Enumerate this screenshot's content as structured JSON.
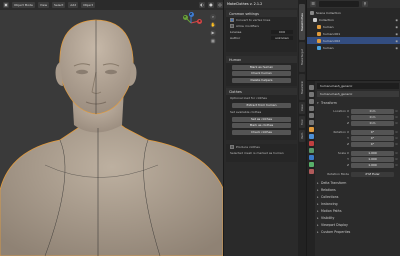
{
  "viewport": {
    "header_buttons": [
      "Object Mode",
      "View",
      "Select",
      "Add",
      "Object"
    ],
    "gizmo": {
      "x": "X",
      "y": "Y",
      "z": "Z"
    }
  },
  "npanel": {
    "title": "MakeClothes v. 2.1.2",
    "common": {
      "title": "Common settings",
      "convert_label": "Convert to vertex lines",
      "allow_label": "Allow modifiers",
      "license_label": "License",
      "license_value": "CC0",
      "author_label": "Author",
      "author_value": "unknown"
    },
    "human": {
      "title": "Human",
      "buttons": [
        "Mark as human",
        "Check human",
        "Delete helpers"
      ]
    },
    "clothes": {
      "title": "Clothes",
      "optional_label": "Optional load for clothes",
      "extract_btn": "Extract from human",
      "base_label": "Set available clothes",
      "set_btn": "Set as clothes",
      "mark_btn": "Mark as clothes",
      "check_btn": "Check clothes"
    },
    "produce": {
      "title": "Produce clothes",
      "status": "Selected mesh is marked as human"
    }
  },
  "vertical_tabs": [
    "MakeClothes",
    "MakeTarget",
    "MakeSkin",
    "View",
    "Tool",
    "Item"
  ],
  "outliner": {
    "rows": [
      {
        "label": "Scene Collection",
        "selected": false,
        "icon_color": "#888888"
      },
      {
        "label": "Collection",
        "selected": false,
        "icon_color": "#cccccc"
      },
      {
        "label": "human",
        "selected": false,
        "icon_color": "#e09b3c"
      },
      {
        "label": "human:001",
        "selected": false,
        "icon_color": "#e09b3c"
      },
      {
        "label": "human:002",
        "selected": true,
        "icon_color": "#e09b3c"
      },
      {
        "label": "human",
        "selected": false,
        "icon_color": "#4aa3df"
      }
    ]
  },
  "properties": {
    "object_name": "human.mesh_generic",
    "object_name2": "human.mesh_generic",
    "transform_title": "Transform",
    "location_label": "Location X",
    "location": [
      "0 m",
      "0 m",
      "0 m"
    ],
    "rotation_label": "Rotation X",
    "rotation": [
      "0°",
      "0°",
      "0°"
    ],
    "scale_label": "Scale X",
    "scale": [
      "1.000",
      "1.000",
      "1.000"
    ],
    "axis_labels": [
      "Y",
      "Z"
    ],
    "rotation_mode_label": "Rotation Mode",
    "rotation_mode": "XYZ Euler",
    "sections": [
      "Delta Transform",
      "Relations",
      "Collections",
      "Instancing",
      "Motion Paths",
      "Visibility",
      "Viewport Display",
      "Custom Properties"
    ]
  },
  "colors": {
    "accent": "#4772b3",
    "selection": "#e39b3c",
    "skin": "#b9ab9b"
  }
}
